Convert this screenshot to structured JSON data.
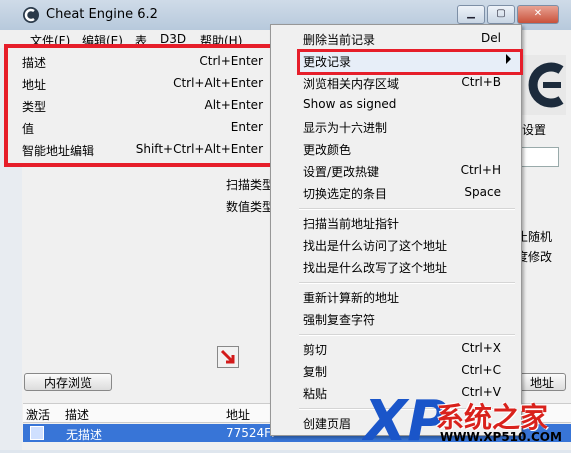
{
  "window": {
    "title": "Cheat Engine 6.2",
    "menu": [
      "文件(F)",
      "编辑(E)",
      "表",
      "D3D",
      "帮助(H)"
    ]
  },
  "main": {
    "scan_type_label": "扫描类型",
    "value_type_label": "数值类型",
    "settings_label": "设置",
    "right_text_1": "止随机",
    "right_text_2": "度修改",
    "memory_view_button": "内存浏览",
    "add_address_button": "地址"
  },
  "address_list": {
    "headers": [
      "激活",
      "描述",
      "地址"
    ],
    "rows": [
      {
        "description": "无描述",
        "address": "77524FF"
      }
    ]
  },
  "left_menu": {
    "items": [
      {
        "label": "描述",
        "shortcut": "Ctrl+Enter"
      },
      {
        "label": "地址",
        "shortcut": "Ctrl+Alt+Enter"
      },
      {
        "label": "类型",
        "shortcut": "Alt+Enter"
      },
      {
        "label": "值",
        "shortcut": "Enter"
      },
      {
        "label": "智能地址编辑",
        "shortcut": "Shift+Ctrl+Alt+Enter"
      }
    ]
  },
  "context_menu": {
    "groups": [
      [
        {
          "label": "删除当前记录",
          "shortcut": "Del"
        },
        {
          "label": "更改记录",
          "shortcut": "",
          "submenu": true
        },
        {
          "label": "浏览相关内存区域",
          "shortcut": "Ctrl+B"
        },
        {
          "label": "Show as signed",
          "shortcut": ""
        },
        {
          "label": "显示为十六进制",
          "shortcut": ""
        },
        {
          "label": "更改颜色",
          "shortcut": ""
        },
        {
          "label": "设置/更改热键",
          "shortcut": "Ctrl+H"
        },
        {
          "label": "切换选定的条目",
          "shortcut": "Space"
        }
      ],
      [
        {
          "label": "扫描当前地址指针",
          "shortcut": ""
        },
        {
          "label": "找出是什么访问了这个地址",
          "shortcut": ""
        },
        {
          "label": "找出是什么改写了这个地址",
          "shortcut": ""
        }
      ],
      [
        {
          "label": "重新计算新的地址",
          "shortcut": ""
        },
        {
          "label": "强制复查字符",
          "shortcut": ""
        }
      ],
      [
        {
          "label": "剪切",
          "shortcut": "Ctrl+X"
        },
        {
          "label": "复制",
          "shortcut": "Ctrl+C"
        },
        {
          "label": "粘贴",
          "shortcut": "Ctrl+V"
        }
      ],
      [
        {
          "label": "创建页眉",
          "shortcut": ""
        }
      ]
    ]
  },
  "watermark": {
    "brand": "系统之家",
    "url": "WWW.XP510.COM",
    "logo_letters": "XP"
  },
  "colors": {
    "highlight_red": "#e61e2a",
    "selection_blue": "#3875d7",
    "watermark_blue": "#1a55c9",
    "watermark_red": "#d9221c"
  }
}
